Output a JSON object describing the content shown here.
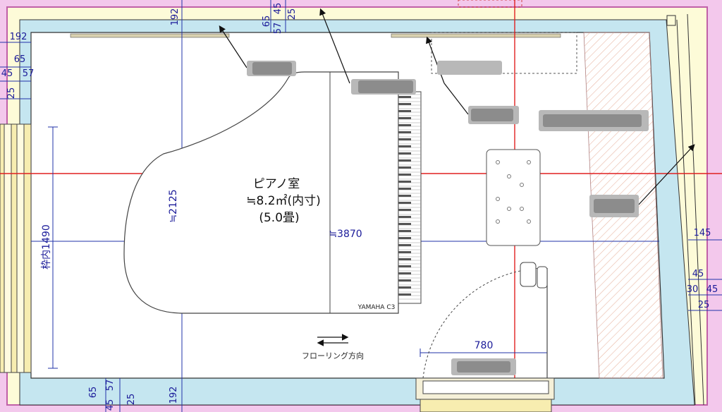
{
  "room": {
    "name": "ピアノ室",
    "area": "≒8.2㎡(内寸)",
    "tatami": "(5.0畳)"
  },
  "piano": {
    "label": "YAMAHA C3"
  },
  "flooring": {
    "label": "フローリング方向"
  },
  "dimensions": {
    "width": "≒3870",
    "depth": "≒2125",
    "window_inner": "枠内1490",
    "door_width": "780",
    "d192": "192",
    "d65": "65",
    "d45": "45",
    "d57": "57",
    "d25": "25",
    "d145": "145",
    "d30": "30"
  },
  "colors": {
    "outer_wall": "#f2c6ea",
    "outer_wall_edge": "#c060a8",
    "insulation": "#fdfbd8",
    "inner_panel": "#c3e4ef",
    "gridline_red": "#e02020",
    "dimension_blue": "#2233aa",
    "hatch": "#e8b8a8"
  }
}
